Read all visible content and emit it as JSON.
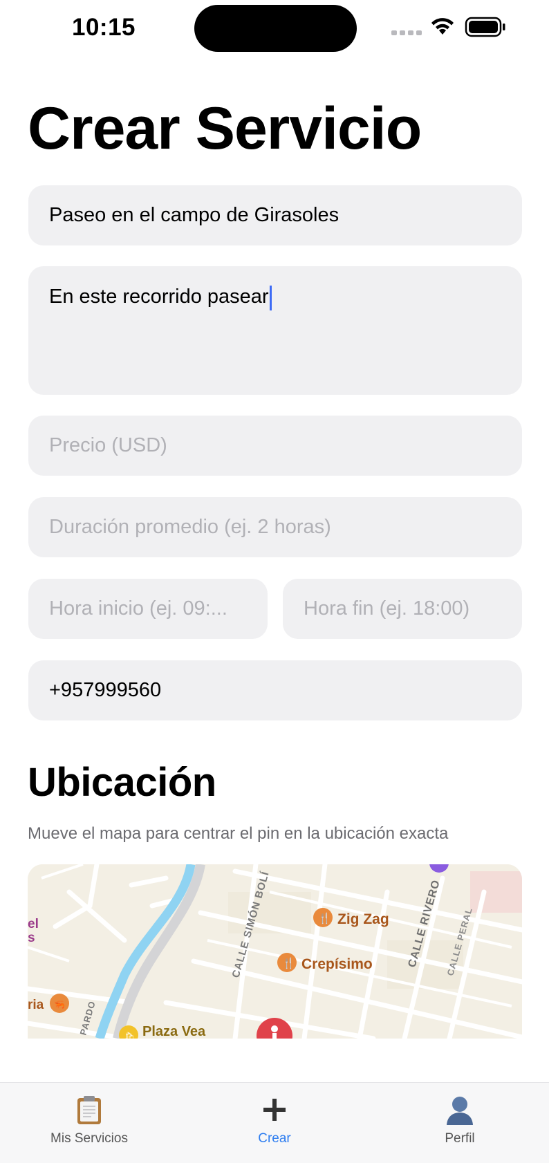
{
  "status_bar": {
    "time": "10:15"
  },
  "title": "Crear Servicio",
  "form": {
    "name_value": "Paseo en el campo de Girasoles",
    "description_value": "En este recorrido pasear",
    "price_placeholder": "Precio (USD)",
    "duration_placeholder": "Duración promedio (ej. 2 horas)",
    "start_placeholder": "Hora inicio (ej. 09:...",
    "end_placeholder": "Hora fin (ej. 18:00)",
    "phone_value": "+957999560"
  },
  "location": {
    "title": "Ubicación",
    "subtitle": "Mueve el mapa para centrar el pin en la ubicación exacta"
  },
  "map": {
    "streets": [
      "CALLE SIMÓN BOLÍ",
      "CALLE RIVERO",
      "CALLE PERAL",
      "PARDO"
    ],
    "pois": [
      {
        "name": "Zig Zag",
        "icon": "restaurant-icon"
      },
      {
        "name": "Crepísimo",
        "icon": "restaurant-icon"
      },
      {
        "name": "Plaza Vea",
        "icon": "shopping-icon"
      },
      {
        "name": "ria",
        "icon": "seafood-icon"
      },
      {
        "name": "el",
        "icon": ""
      },
      {
        "name": "s",
        "icon": ""
      }
    ],
    "colors": {
      "land": "#f3efe4",
      "river": "#8fd3f2",
      "poi_orange": "#e98a3c",
      "poi_text": "#a8561b",
      "pin": "#e0424a"
    }
  },
  "tabs": [
    {
      "label": "Mis Servicios",
      "icon": "clipboard-icon",
      "active": false
    },
    {
      "label": "Crear",
      "icon": "plus-icon",
      "active": true
    },
    {
      "label": "Perfil",
      "icon": "person-icon",
      "active": false
    }
  ],
  "accent_color": "#2f7ef0"
}
